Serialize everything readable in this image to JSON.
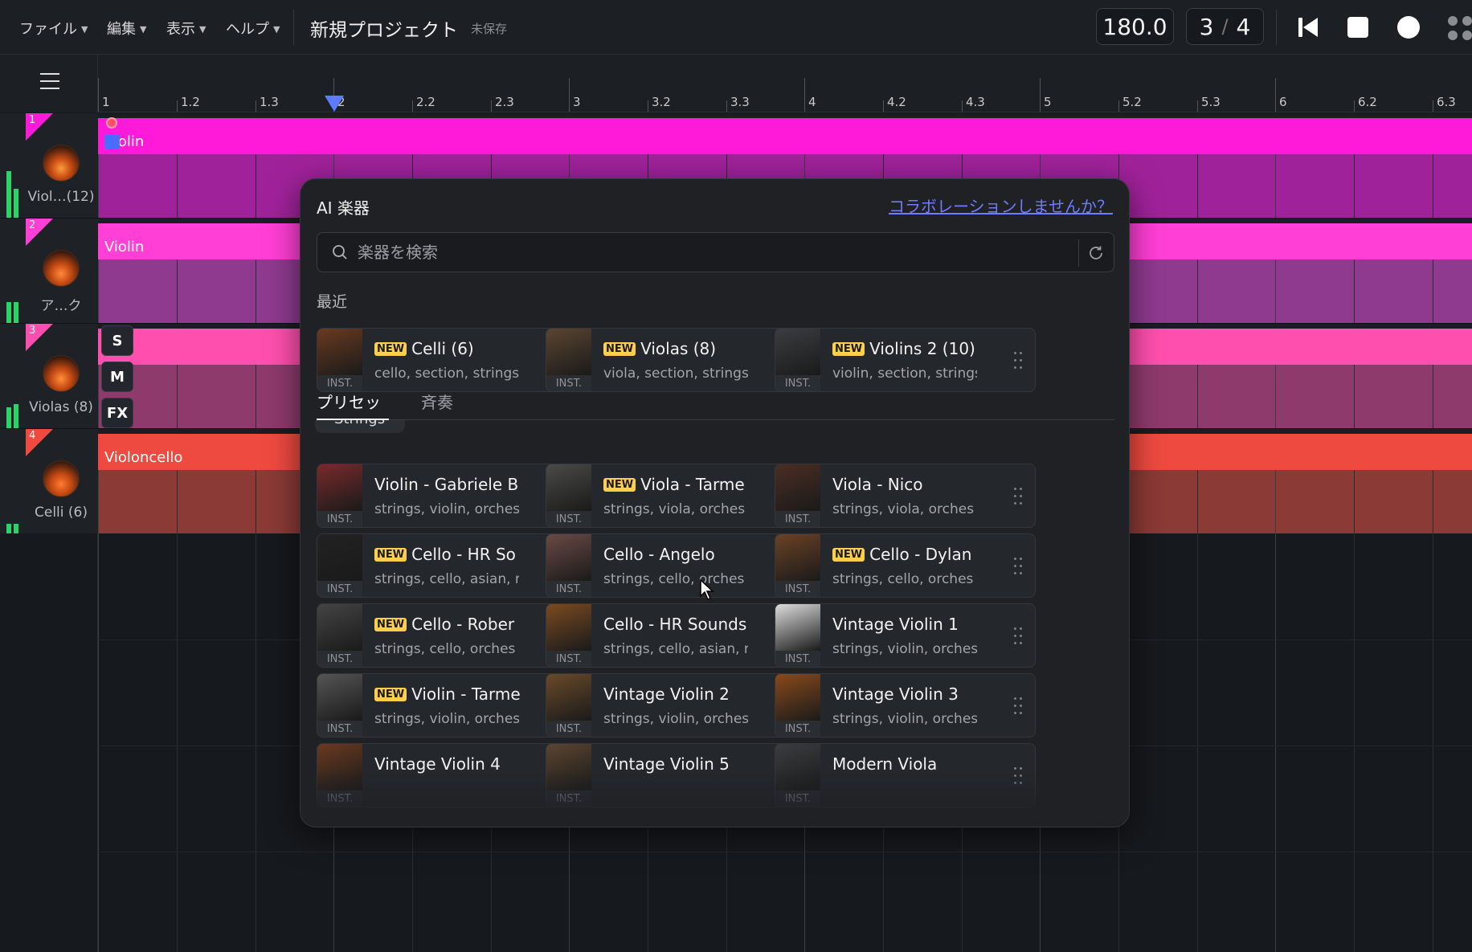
{
  "menu": {
    "file": "ファイル",
    "edit": "編集",
    "view": "表示",
    "help": "ヘルプ"
  },
  "project": {
    "title": "新規プロジェクト",
    "status": "未保存"
  },
  "transport": {
    "tempo": "180.0",
    "ts_num": "3",
    "ts_slash": "/",
    "ts_den": "4"
  },
  "ruler": {
    "labels": [
      "1",
      "1.2",
      "1.3",
      "2",
      "2.2",
      "2.3",
      "3",
      "3.2",
      "3.3",
      "4",
      "4.2",
      "4.3",
      "5",
      "5.2",
      "5.3",
      "6",
      "6.2",
      "6.3"
    ]
  },
  "tracks": [
    {
      "num": "1",
      "name": "Viol…(12)",
      "region": "Violin",
      "color_top": "#ff1ad9",
      "color_body": "#a0229a"
    },
    {
      "num": "2",
      "name": "ア…ク",
      "region": "Violin",
      "color_top": "#ff3fd6",
      "color_body": "#8f3a8f"
    },
    {
      "num": "3",
      "name": "Violas (8)",
      "region": "",
      "color_top": "#ff4fae",
      "color_body": "#8e3a6c"
    },
    {
      "num": "4",
      "name": "Celli (6)",
      "region": "Violoncello",
      "color_top": "#ee4a40",
      "color_body": "#8b3a36"
    }
  ],
  "track_buttons": {
    "solo": "S",
    "mute": "M",
    "fx": "FX"
  },
  "panel": {
    "title": "AI 楽器",
    "collab_link": "コラボレーションしませんか？",
    "search_placeholder": "楽器を検索",
    "recent_label": "最近",
    "tabs": [
      "プリセット",
      "斉奏"
    ],
    "peek_chip": "Strings",
    "new_badge": "NEW",
    "inst_label": "INST.",
    "recent": [
      {
        "name": "Celli (6)",
        "tags": "cello, section, strings",
        "new": true
      },
      {
        "name": "Violas (8)",
        "tags": "viola, section, strings",
        "new": true
      },
      {
        "name": "Violins 2 (10)",
        "tags": "violin, section, strings",
        "new": true
      }
    ],
    "presets": [
      {
        "name": "Violin - Gabriele B",
        "tags": "strings, violin, orches",
        "new": false
      },
      {
        "name": "Viola - Tarme",
        "tags": "strings, viola, orches",
        "new": true
      },
      {
        "name": "Viola - Nico",
        "tags": "strings, viola, orches",
        "new": false
      },
      {
        "name": "Cello - HR So",
        "tags": "strings, cello, asian, r",
        "new": true
      },
      {
        "name": "Cello - Angelo",
        "tags": "strings, cello, orches",
        "new": false
      },
      {
        "name": "Cello - Dylan",
        "tags": "strings, cello, orches",
        "new": true
      },
      {
        "name": "Cello - Rober",
        "tags": "strings, cello, orches",
        "new": true
      },
      {
        "name": "Cello - HR Sounds",
        "tags": "strings, cello, asian, r",
        "new": false
      },
      {
        "name": "Vintage Violin 1",
        "tags": "strings, violin, orches",
        "new": false
      },
      {
        "name": "Violin - Tarme",
        "tags": "strings, violin, orches",
        "new": true
      },
      {
        "name": "Vintage Violin 2",
        "tags": "strings, violin, orches",
        "new": false
      },
      {
        "name": "Vintage Violin 3",
        "tags": "strings, violin, orches",
        "new": false
      },
      {
        "name": "Vintage Violin 4",
        "tags": "",
        "new": false
      },
      {
        "name": "Vintage Violin 5",
        "tags": "",
        "new": false
      },
      {
        "name": "Modern Viola",
        "tags": "",
        "new": false
      }
    ]
  },
  "colors": {
    "accent": "#5b7cff",
    "link": "#6e7cff",
    "new_badge": "#ffcf4a",
    "meter": "#2bd46a"
  }
}
